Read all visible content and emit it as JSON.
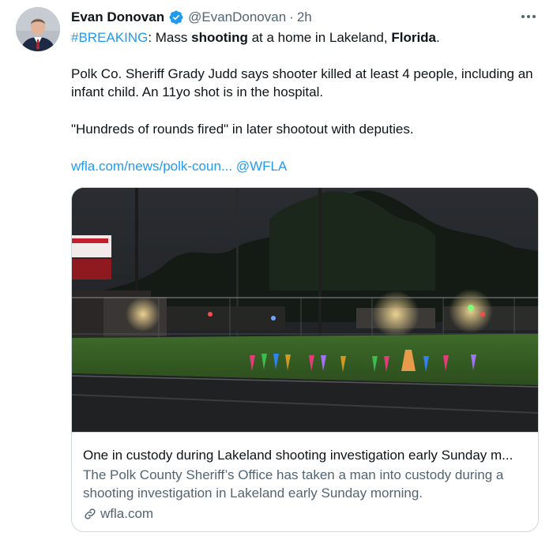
{
  "tweet": {
    "author_name": "Evan Donovan",
    "handle": "@EvanDonovan",
    "separator": "·",
    "time": "2h",
    "text": {
      "hashtag": "#BREAKING",
      "line1_a": ": Mass ",
      "line1_bold1": "shooting",
      "line1_b": " at a home in Lakeland, ",
      "line1_bold2": "Florida",
      "line1_c": ".",
      "para2": "Polk Co. Sheriff Grady Judd says shooter killed at least 4 people, including an infant child. An 11yo shot is in the hospital.",
      "para3": "\"Hundreds of rounds fired\" in later shootout with deputies.",
      "link": "wfla.com/news/polk-coun...",
      "mention": "@WFLA"
    }
  },
  "card": {
    "title": "One in custody during Lakeland shooting investigation early Sunday m...",
    "description": "The Polk County Sheriff’s Office has taken a man into custody during a shooting investigation in Lakeland early Sunday morning.",
    "domain": "wfla.com"
  },
  "icons": {
    "verified": "verified-badge-icon",
    "more": "more-options-icon",
    "link": "link-icon"
  },
  "colors": {
    "accent": "#1d9bf0",
    "secondary_text": "#536471",
    "border": "#cfd9de"
  }
}
